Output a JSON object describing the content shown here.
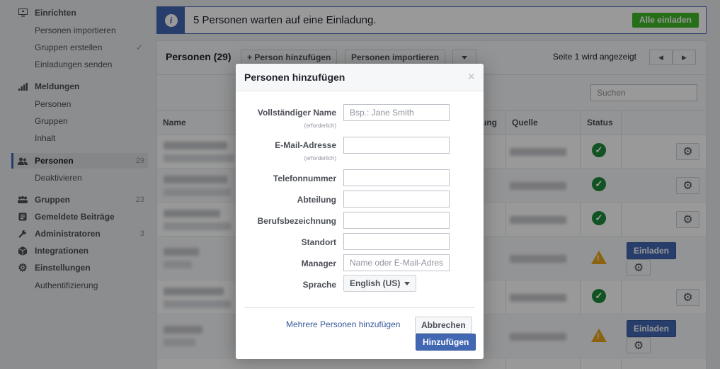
{
  "sidebar": {
    "sections": [
      {
        "label": "Einrichten",
        "icon": "monitor-icon",
        "items": [
          "Personen importieren",
          "Gruppen erstellen",
          "Einladungen senden"
        ]
      },
      {
        "label": "Meldungen",
        "icon": "bar-chart-icon",
        "items": [
          "Personen",
          "Gruppen",
          "Inhalt"
        ]
      },
      {
        "label": "Personen",
        "icon": "people-icon",
        "count": "29",
        "items": [
          "Deaktivieren"
        ]
      },
      {
        "label": "Gruppen",
        "icon": "groups-icon",
        "count": "23"
      },
      {
        "label": "Gemeldete Beiträge",
        "icon": "report-icon"
      },
      {
        "label": "Administratoren",
        "icon": "wrench-icon",
        "count": "3"
      },
      {
        "label": "Integrationen",
        "icon": "cube-icon"
      },
      {
        "label": "Einstellungen",
        "icon": "gear-icon",
        "items": [
          "Authentifizierung"
        ]
      }
    ]
  },
  "banner": {
    "message": "5 Personen warten auf eine Einladung.",
    "invite_all_label": "Alle einladen"
  },
  "panel": {
    "title": "Personen (29)",
    "add_person_label": "+ Person hinzufügen",
    "import_label": "Personen importieren",
    "page_text": "Seite 1 wird angezeigt",
    "search_placeholder": "Suchen",
    "columns": {
      "name": "Name",
      "department_partial": "ung",
      "source": "Quelle",
      "status": "Status"
    },
    "invite_label": "Einladen",
    "rows": [
      {
        "status": "ok"
      },
      {
        "status": "ok"
      },
      {
        "status": "ok"
      },
      {
        "status": "warning"
      },
      {
        "status": "ok"
      },
      {
        "status": "warning"
      }
    ]
  },
  "modal": {
    "title": "Personen hinzufügen",
    "close": "×",
    "required_note": "(erforderlich)",
    "fields": {
      "full_name": {
        "label": "Vollständiger Name",
        "placeholder": "Bsp.: Jane Smith",
        "value": ""
      },
      "email": {
        "label": "E-Mail-Adresse",
        "value": ""
      },
      "phone": {
        "label": "Telefonnummer",
        "value": ""
      },
      "department": {
        "label": "Abteilung",
        "value": ""
      },
      "job_title": {
        "label": "Berufsbezeichnung",
        "value": ""
      },
      "location": {
        "label": "Standort",
        "value": ""
      },
      "manager": {
        "label": "Manager",
        "placeholder": "Name oder E-Mail-Adres",
        "value": ""
      },
      "language": {
        "label": "Sprache",
        "value": "English (US)"
      }
    },
    "add_multiple_link": "Mehrere Personen hinzufügen",
    "cancel_label": "Abbrechen",
    "add_label": "Hinzufügen"
  },
  "colors": {
    "accent": "#4267b2",
    "success": "#42b72a",
    "ok_status": "#1e8b3b",
    "warning_status": "#e8a317"
  }
}
